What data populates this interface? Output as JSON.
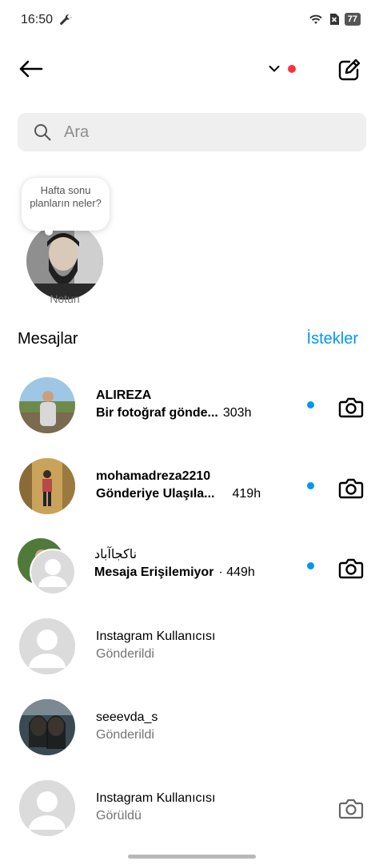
{
  "status": {
    "time": "16:50",
    "battery": "77"
  },
  "colors": {
    "accent": "#0095f6",
    "notification": "#ff3040",
    "secondary_text": "#737373"
  },
  "search": {
    "placeholder": "Ara"
  },
  "note": {
    "text": "Hafta sonu planların neler?",
    "label": "Notun"
  },
  "messages_section": {
    "title": "Mesajlar",
    "requests_label": "İstekler"
  },
  "threads": [
    {
      "name": "ALIREZA",
      "preview": "Bir fotoğraf gönde...",
      "time": "303h",
      "unread": true,
      "camera": "camera-icon"
    },
    {
      "name": "mohamadreza2210",
      "preview": "Gönderiye Ulaşıla...",
      "time": "419h",
      "unread": true,
      "camera": "camera-icon"
    },
    {
      "name": "ناکجاآباد",
      "preview": "Mesaja Erişilemiyor",
      "time": "· 449h",
      "unread": true,
      "camera": "camera-icon"
    },
    {
      "name": "Instagram Kullanıcısı",
      "preview": "Gönderildi",
      "time": "",
      "unread": false
    },
    {
      "name": "seeevda_s",
      "preview": "Gönderildi",
      "time": "",
      "unread": false
    },
    {
      "name": "Instagram Kullanıcısı",
      "preview": "Görüldü",
      "time": "",
      "unread": false,
      "camera": "camera-icon"
    }
  ]
}
